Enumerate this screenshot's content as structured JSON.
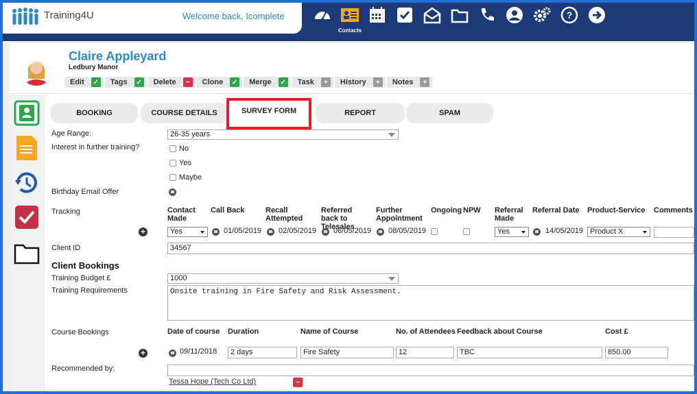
{
  "app": {
    "brand": "Training4U",
    "welcome": "Welcome back, Icomplete"
  },
  "nav": {
    "active_label": "Contacts",
    "icons": [
      "dashboard-icon",
      "contacts-icon",
      "calendar-icon",
      "tasks-icon",
      "mail-icon",
      "folder-icon",
      "phone-icon",
      "account-icon",
      "settings-icon",
      "help-icon",
      "logout-icon"
    ]
  },
  "contact": {
    "name": "Claire Appleyard",
    "company": "Ledbury Manor"
  },
  "actions": [
    {
      "label": "Edit",
      "state": "green"
    },
    {
      "label": "Tags",
      "state": "green"
    },
    {
      "label": "Delete",
      "state": "red"
    },
    {
      "label": "Clone",
      "state": "green"
    },
    {
      "label": "Merge",
      "state": "green"
    },
    {
      "label": "Task",
      "state": "grey"
    },
    {
      "label": "History",
      "state": "grey"
    },
    {
      "label": "Notes",
      "state": "grey"
    }
  ],
  "sidebar_icons": [
    "contact-card-icon",
    "document-icon",
    "history-icon",
    "task-check-icon",
    "folder-icon"
  ],
  "tabs": [
    "BOOKING",
    "COURSE DETAILS",
    "SURVEY FORM",
    "REPORT",
    "SPAM"
  ],
  "form": {
    "age_range": {
      "label": "Age Range:",
      "value": "26-35 years"
    },
    "interest": {
      "label": "Interest in further training?",
      "options": [
        "No",
        "Yes",
        "Maybe"
      ]
    },
    "birthday": {
      "label": "Birthday Email Offer"
    },
    "tracking": {
      "label": "Tracking",
      "headers": {
        "contact_made": "Contact Made",
        "call_back": "Call Back",
        "recall": "Recall Attempted",
        "referred": "Referred back to Telesales",
        "further": "Further Appointment",
        "ongoing": "Ongoing",
        "npw": "NPW",
        "referral_made": "Referral Made",
        "referral_date": "Referral Date",
        "product": "Product-Service",
        "comments": "Comments"
      },
      "values": {
        "contact_made": "Yes",
        "call_back": "01/05/2019",
        "recall": "02/05/2019",
        "referred": "06/05/2019",
        "further": "08/05/2019",
        "referral_made": "Yes",
        "referral_date": "14/05/2019",
        "product": "Product X"
      }
    },
    "client_id": {
      "label": "Client ID",
      "value": "34567"
    },
    "client_bookings_title": "Client Bookings",
    "training_budget": {
      "label": "Training Budget £",
      "value": "1000"
    },
    "training_requirements": {
      "label": "Training Requirements",
      "value": "Onsite training in Fire Safety and Risk Assessment."
    },
    "course_bookings": {
      "label": "Course Bookings",
      "headers": {
        "date": "Date of course",
        "duration": "Duration",
        "name": "Name of Course",
        "attendees": "No. of Attendees",
        "feedback": "Feedback about Course",
        "cost": "Cost £"
      },
      "values": {
        "date": "09/11/2018",
        "duration": "2 days",
        "name": "Fire Safety",
        "attendees": "12",
        "feedback": "TBC",
        "cost": "850.00"
      }
    },
    "recommended": {
      "label": "Recommended by:",
      "value": "Tessa Hope (Tech Co Ltd)"
    }
  },
  "colors": {
    "accent": "#2a8ac8",
    "navy": "#1d3a78",
    "highlight": "#e0202a",
    "green": "#29a84a"
  }
}
